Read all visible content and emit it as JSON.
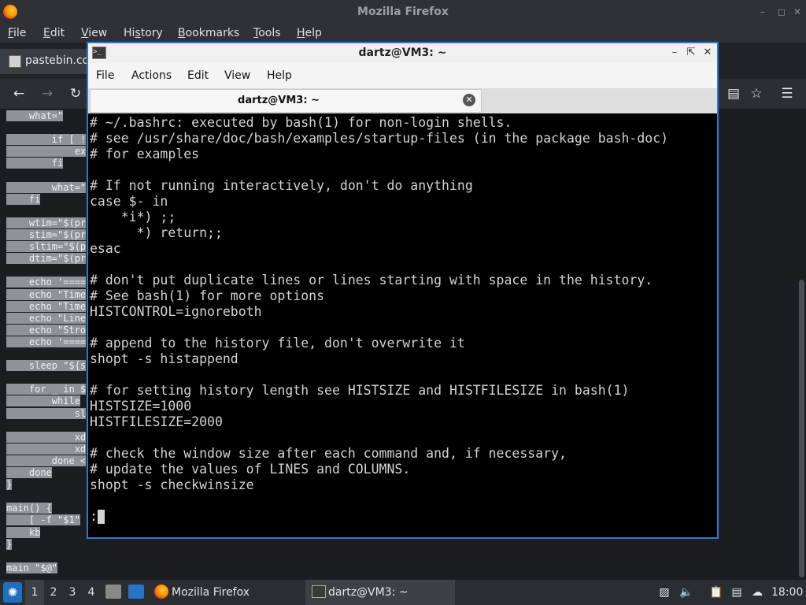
{
  "firefox": {
    "title": "Mozilla Firefox",
    "menu": [
      "File",
      "Edit",
      "View",
      "History",
      "Bookmarks",
      "Tools",
      "Help"
    ],
    "menu_mnemonics": [
      "F",
      "E",
      "V",
      "s",
      "B",
      "T",
      "H"
    ],
    "tab_label": "pastebin.co",
    "window_controls": [
      "minimize",
      "maximize",
      "close"
    ]
  },
  "page_code_lines": [
    "    what=\"",
    "",
    "        if [ !",
    "            ex",
    "        fi",
    "",
    "        what=\"",
    "    fi",
    "",
    "    wtim=\"$(pr",
    "    stim=\"$(pr",
    "    sltim=\"$(p",
    "    dtim=\"$(pr",
    "",
    "    echo '====",
    "    echo \"Time",
    "    echo \"Time",
    "    echo \"Line",
    "    echo \"Stro",
    "    echo '====",
    "",
    "    sleep \"${s",
    "",
    "    for _ in $",
    "        while",
    "            sl",
    "",
    "            xd",
    "            xd",
    "        done <",
    "    done",
    "}",
    "",
    "main() {",
    "    [ -f \"$1\"",
    "    kb",
    "}",
    "",
    "main \"$@\""
  ],
  "terminal": {
    "title": "dartz@VM3: ~",
    "menu": [
      "File",
      "Actions",
      "Edit",
      "View",
      "Help"
    ],
    "tab_label": "dartz@VM3: ~",
    "lines": [
      "# ~/.bashrc: executed by bash(1) for non-login shells.",
      "# see /usr/share/doc/bash/examples/startup-files (in the package bash-doc)",
      "# for examples",
      "",
      "# If not running interactively, don't do anything",
      "case $- in",
      "    *i*) ;;",
      "      *) return;;",
      "esac",
      "",
      "# don't put duplicate lines or lines starting with space in the history.",
      "# See bash(1) for more options",
      "HISTCONTROL=ignoreboth",
      "",
      "# append to the history file, don't overwrite it",
      "shopt -s histappend",
      "",
      "# for setting history length see HISTSIZE and HISTFILESIZE in bash(1)",
      "HISTSIZE=1000",
      "HISTFILESIZE=2000",
      "",
      "# check the window size after each command and, if necessary,",
      "# update the values of LINES and COLUMNS.",
      "shopt -s checkwinsize",
      "",
      ":"
    ]
  },
  "taskbar": {
    "workspaces": [
      "1",
      "2",
      "3",
      "4"
    ],
    "active_workspace": "1",
    "tasks": [
      {
        "label": "Mozilla Firefox",
        "icon": "firefox-icon"
      },
      {
        "label": "dartz@VM3: ~",
        "icon": "terminal-icon"
      }
    ],
    "clock": "18:00"
  },
  "colors": {
    "terminal_border": "#2d7ad1",
    "selection_bg": "#8f9297"
  }
}
